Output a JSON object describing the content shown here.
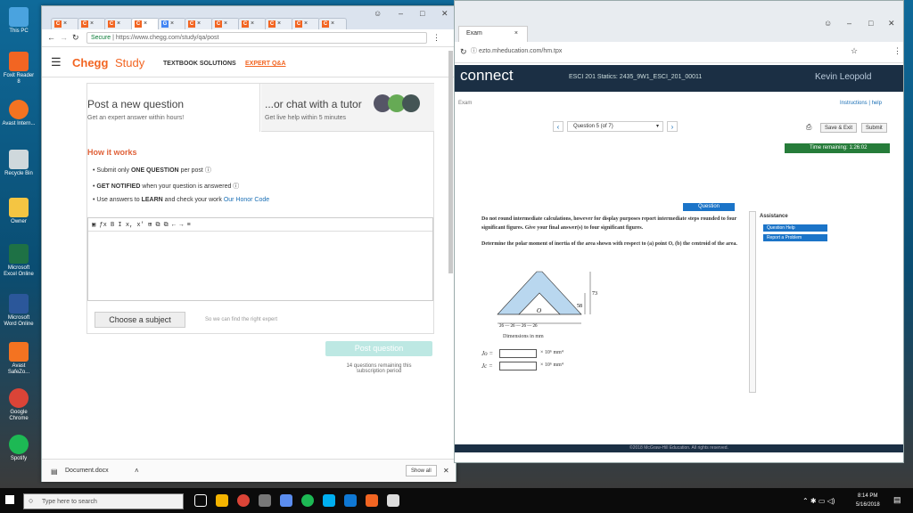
{
  "desktop": {
    "icons": [
      "This PC",
      "Foxit Reader 8",
      "Avast Intern...",
      "Recycle Bin",
      "Owner",
      "Microsoft Excel Online",
      "Microsoft Word Online",
      "Avast SafeZo...",
      "Google Chrome",
      "Spotify"
    ]
  },
  "chegg": {
    "tabs": [
      "C",
      "C",
      "C",
      "C",
      "G",
      "C",
      "C",
      "C",
      "C",
      "C",
      "C"
    ],
    "url": "https://www.chegg.com/study/qa/post",
    "secure": "Secure",
    "brand": "Chegg",
    "brand2": "Study",
    "nav1": "TEXTBOOK SOLUTIONS",
    "nav2": "EXPERT Q&A",
    "post_title": "Post a new question",
    "post_sub": "Get an expert answer within hours!",
    "chat_title": "...or chat with a tutor",
    "chat_sub": "Get live help within 5 minutes",
    "how_title": "How it works",
    "how1a": "Submit only ",
    "how1b": "ONE QUESTION",
    " how1c": " per post",
    "how1c2": " per post",
    "how2a": "GET NOTIFIED",
    "how2b": " when your question is answered",
    "how3a": "Use answers to ",
    "how3b": "LEARN",
    "how3c": " and check your work ",
    "how3d": "Our Honor Code",
    "choose": "Choose a subject",
    "choose_hint": "So we can find the right expert",
    "post_btn": "Post question",
    "remaining1": "14 questions remaining this",
    "remaining2": "subscription period",
    "download": "Document.docx",
    "show_all": "Show all"
  },
  "connect": {
    "tab": "Exam",
    "url": "ezto.mheducation.com/hm.tpx",
    "logo": "connect",
    "course": "ESCI 201 Statics: 2435_9W1_ESCI_201_00011",
    "user": "Kevin Leopold",
    "exam": "Exam",
    "links": "Instructions | help",
    "qsel": "Question 5 (of 7)",
    "save": "Save & Exit",
    "submit": "Submit",
    "timer": "Time remaining: 1:26:02",
    "qhead": "Question",
    "p1": "Do not round intermediate calculations, however for display purposes report intermediate steps rounded to four significant figures. Give your final answer(s) to four significant figures.",
    "p2": "Determine the polar moment of inertia of the area shown with respect to (a) point O, (b) the centroid of the area.",
    "dim58": "58",
    "dim73": "73",
    "dimO": "O",
    "dims": "26 — 26 — 26 — 26",
    "dimcap": "Dimensions in mm",
    "jo": "Jo =",
    "jc": "Jc =",
    "unit": "× 10⁶ mm⁴",
    "assist": "Assistance",
    "qhelp": "Question Help",
    "report": "Report a Problem",
    "copyright": "©2018 McGraw-Hill Education. All rights reserved."
  },
  "taskbar": {
    "search": "Type here to search",
    "time": "8:14 PM",
    "date": "5/16/2018"
  }
}
